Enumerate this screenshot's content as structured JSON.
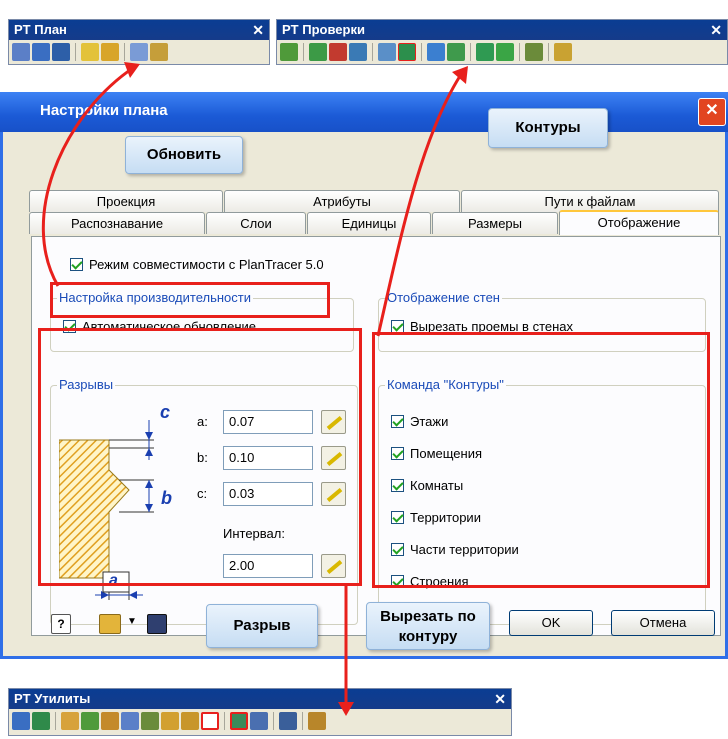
{
  "toolbar_plan": {
    "title": "PT План",
    "close": "✕"
  },
  "toolbar_checks": {
    "title": "PT Проверки",
    "close": "✕"
  },
  "toolbar_utils": {
    "title": "PT Утилиты",
    "close": "✕"
  },
  "dialog": {
    "title": "Настройки плана",
    "close": "✕",
    "tabs_back": [
      "Проекция",
      "Атрибуты",
      "Пути к файлам"
    ],
    "tabs_front": [
      "Распознавание",
      "Слои",
      "Единицы",
      "Размеры",
      "Отображение"
    ],
    "compat_mode": "Режим совместимости с PlanTracer 5.0",
    "perf_group": "Настройка производительности",
    "auto_update": "Автоматическое обновление",
    "walls_group": "Отображение стен",
    "cut_openings": "Вырезать проемы в стенах",
    "gaps_group": "Разрывы",
    "gap_a_label": "a:",
    "gap_a_value": "0.07",
    "gap_b_label": "b:",
    "gap_b_value": "0.10",
    "gap_c_label": "c:",
    "gap_c_value": "0.03",
    "interval_label": "Интервал:",
    "interval_value": "2.00",
    "diagram_c": "c",
    "diagram_b": "b",
    "diagram_a": "a",
    "contours_group": "Команда \"Контуры\"",
    "contour_items": [
      "Этажи",
      "Помещения",
      "Комнаты",
      "Территории",
      "Части территории",
      "Строения"
    ],
    "ok_label": "OK",
    "cancel_label": "Отмена"
  },
  "callouts": {
    "update": "Обновить",
    "contours": "Контуры",
    "gap": "Разрыв",
    "cut_by_contour": "Вырезать по контуру"
  },
  "colors": {
    "accent": "#e8201c",
    "title_blue": "#1b5ad6",
    "group_label": "#1a4bb8"
  }
}
